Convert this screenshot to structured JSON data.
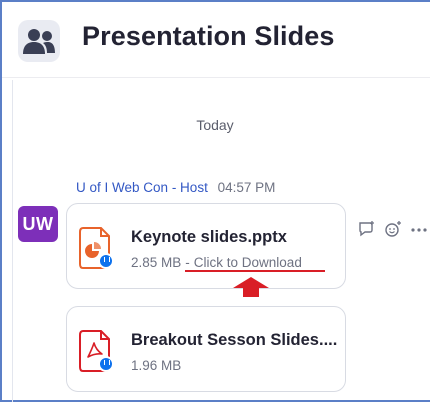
{
  "channel": {
    "title": "Presentation Slides",
    "icon": "group-icon"
  },
  "divider": {
    "label": "Today"
  },
  "message": {
    "sender": "U of I Web Con",
    "role": "- Host",
    "time": "04:57 PM",
    "avatar_initials": "UW",
    "avatar_color": "#7d2fb9",
    "files": [
      {
        "name": "Keynote slides.pptx",
        "size": "2.85 MB",
        "action": "Click to Download",
        "icon": "powerpoint-file-icon",
        "accent": "#e8632b"
      },
      {
        "name": "Breakout Sesson Slides....",
        "size": "1.96 MB",
        "icon": "pdf-file-icon",
        "accent": "#d91e26"
      }
    ]
  },
  "actions": {
    "reply_icon": "reply-thread-icon",
    "reaction_icon": "add-reaction-icon",
    "more_icon": "more-options-icon"
  },
  "annotation": {
    "color": "#d91e26"
  }
}
